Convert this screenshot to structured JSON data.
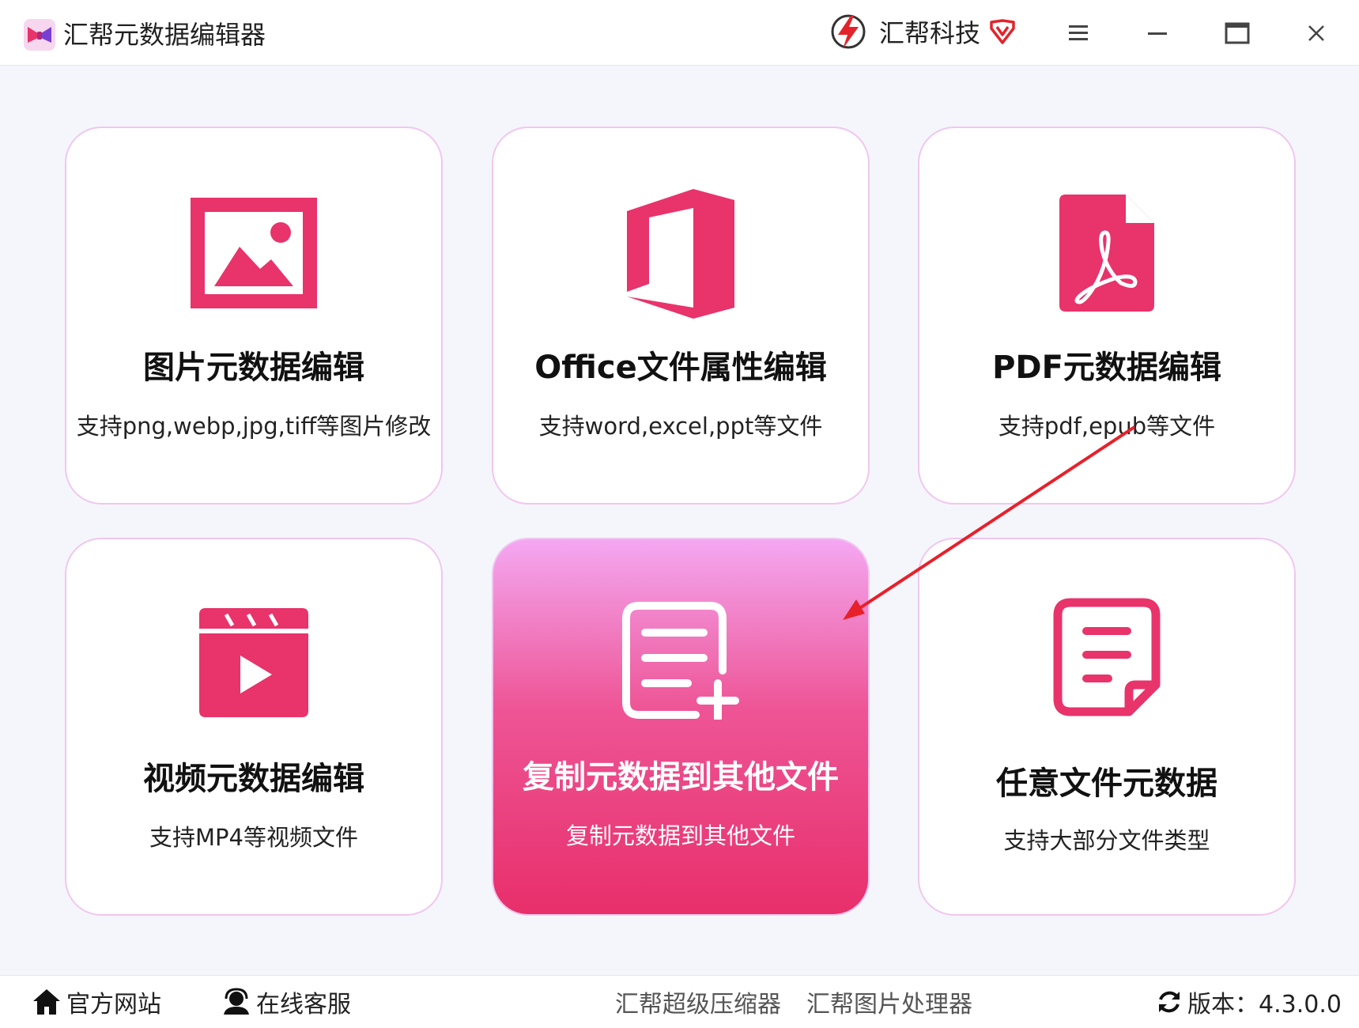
{
  "window": {
    "title": "汇帮元数据编辑器",
    "brand": "汇帮科技",
    "accent_color": "#e8336b",
    "icons": {
      "app_logo": "bow-logo-icon",
      "brand_logo": "lightning-logo-icon",
      "vip": "heart-badge-icon",
      "menu": "hamburger-menu-icon",
      "minimize": "minimize-icon",
      "maximize": "maximize-icon",
      "close": "close-icon"
    }
  },
  "cards": [
    {
      "title": "图片元数据编辑",
      "desc": "支持png,webp,jpg,tiff等图片修改",
      "icon": "image-icon"
    },
    {
      "title": "Office文件属性编辑",
      "desc": "支持word,excel,ppt等文件",
      "icon": "office-icon"
    },
    {
      "title": "PDF元数据编辑",
      "desc": "支持pdf,epub等文件",
      "icon": "pdf-icon"
    },
    {
      "title": "视频元数据编辑",
      "desc": "支持MP4等视频文件",
      "icon": "video-icon"
    },
    {
      "title": "复制元数据到其他文件",
      "desc": "复制元数据到其他文件",
      "icon": "document-add-icon",
      "selected": true
    },
    {
      "title": "任意文件元数据",
      "desc": "支持大部分文件类型",
      "icon": "document-icon"
    }
  ],
  "annotation": {
    "type": "arrow",
    "color": "#e8202a",
    "icon": "red-arrow-icon"
  },
  "footer": {
    "website": "官方网站",
    "support": "在线客服",
    "compressor": "汇帮超级压缩器",
    "image_processor": "汇帮图片处理器",
    "version": "版本：4.3.0.0",
    "icons": {
      "website": "home-icon",
      "support": "headset-user-icon",
      "version": "refresh-icon"
    }
  }
}
